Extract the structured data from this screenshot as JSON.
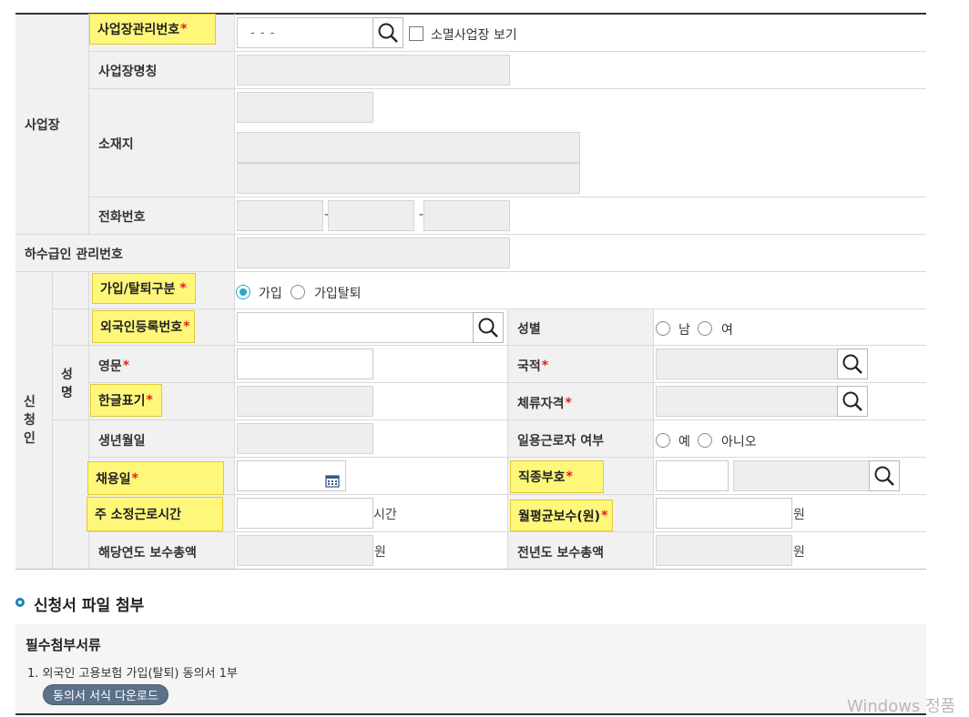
{
  "workplace": {
    "section_label": "사업장",
    "mgmt_no_label": "사업장관리번호",
    "mgmt_no_value": "- -   -",
    "show_closed_label": "소멸사업장 보기",
    "name_label": "사업장명칭",
    "address_label": "소재지",
    "phone_label": "전화번호",
    "phone_sep": "-"
  },
  "subcontractor": {
    "label": "하수급인 관리번호"
  },
  "applicant": {
    "section_label": [
      "신",
      "청",
      "인"
    ],
    "name_group_label": [
      "성",
      "명"
    ],
    "join_type_label": "가입/탈퇴구분",
    "join_option": "가입",
    "leave_option": "가입탈퇴",
    "foreigner_no_label": "외국인등록번호",
    "gender_label": "성별",
    "gender_male": "남",
    "gender_female": "여",
    "english_name_label": "영문",
    "nationality_label": "국적",
    "korean_name_label": "한글표기",
    "visa_label": "체류자격",
    "birth_label": "생년월일",
    "daily_worker_label": "일용근로자 여부",
    "daily_yes": "예",
    "daily_no": "아니오",
    "hire_date_label": "채용일",
    "job_code_label": "직종부호",
    "weekly_hours_label": "주 소정근로시간",
    "hours_unit": "시간",
    "monthly_pay_label": "월평균보수(원)",
    "won_unit": "원",
    "year_total_label": "해당연도 보수총액",
    "prev_year_total_label": "전년도 보수총액"
  },
  "attachment": {
    "section_title": "신청서 파일 첨부",
    "required_title": "필수첨부서류",
    "item_1": "1.  외국인 고용보험 가입(탈퇴) 동의서 1부",
    "download_button": "동의서 서식 다운로드"
  },
  "watermark": "Windows 정품",
  "required_mark": "*",
  "colors": {
    "accent": "#2aa7c7",
    "highlight": "#fff77a",
    "required": "#e02020",
    "button": "#5b7089"
  }
}
